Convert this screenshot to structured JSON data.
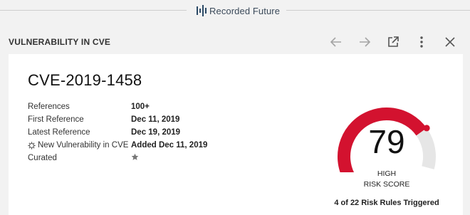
{
  "brand": {
    "name": "Recorded Future"
  },
  "header": {
    "title": "VULNERABILITY IN CVE",
    "actions": [
      "back-arrow-icon",
      "forward-arrow-icon",
      "open-external-icon",
      "more-vertical-icon",
      "close-icon"
    ]
  },
  "card": {
    "cve_id": "CVE-2019-1458",
    "fields": [
      {
        "key": "References",
        "value": "100+"
      },
      {
        "key": "First Reference",
        "value": "Dec 11, 2019"
      },
      {
        "key": "Latest Reference",
        "value": "Dec 19, 2019"
      },
      {
        "key": "New Vulnerability in CVE",
        "value": "Added Dec 11, 2019",
        "icon": "rule-gear-icon"
      },
      {
        "key": "Curated",
        "value": "",
        "icon": "star-icon"
      }
    ],
    "risk": {
      "score": "79",
      "score_value": 79,
      "score_max": 99,
      "level": "HIGH",
      "label": "RISK SCORE",
      "rules_triggered": "4 of 22 Risk Rules Triggered"
    }
  },
  "colors": {
    "accent_red": "#d3122f",
    "gauge_track": "#e6e6e6",
    "background": "#f2f2f2",
    "card": "#ffffff",
    "icon_gray": "#9a9a9a",
    "icon_dark": "#555555"
  }
}
